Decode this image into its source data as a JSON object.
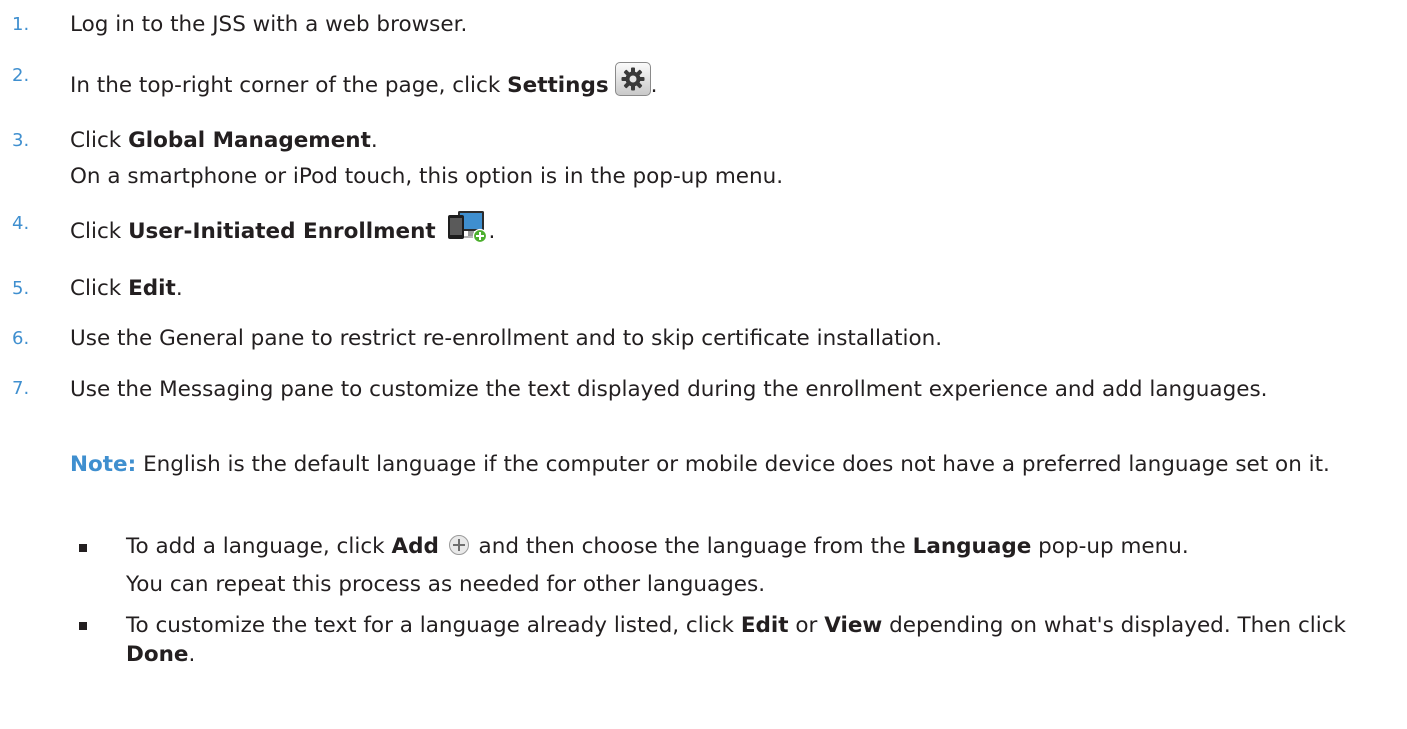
{
  "steps": [
    {
      "num": "1.",
      "text": "Log in to the JSS with a web browser."
    },
    {
      "num": "2.",
      "pre": "In the top-right corner of the page, click ",
      "bold": "Settings",
      "post": ".",
      "icon": "gear-icon"
    },
    {
      "num": "3.",
      "pre": "Click ",
      "bold": "Global Management",
      "post": ".",
      "sub": "On a smartphone or iPod touch, this option is in the pop-up menu."
    },
    {
      "num": "4.",
      "pre": "Click ",
      "bold": "User-Initiated Enrollment",
      "post": ".",
      "icon": "user-enrollment-icon"
    },
    {
      "num": "5.",
      "pre": "Click ",
      "bold": "Edit",
      "post": "."
    },
    {
      "num": "6.",
      "text": "Use the General pane to restrict re-enrollment and to skip certificate installation."
    },
    {
      "num": "7.",
      "text": "Use the Messaging pane to customize the text displayed during the enrollment experience and add languages.",
      "note_label": "Note:",
      "note_text": " English is the default language if the computer or mobile device does not have a preferred language set on it.",
      "bullets": [
        {
          "pre": "To add a language, click ",
          "b1": "Add",
          "mid": " and then choose the language from the ",
          "b2": "Language",
          "post": " pop-up menu.",
          "icon": "add-circle-icon",
          "sub": "You can repeat this process as needed for other languages."
        },
        {
          "pre": "To customize the text for a language already listed, click ",
          "b1": "Edit",
          "mid": " or ",
          "b2": "View",
          "mid2": " depending on what's displayed. Then click ",
          "b3": "Done",
          "post": "."
        }
      ]
    }
  ]
}
